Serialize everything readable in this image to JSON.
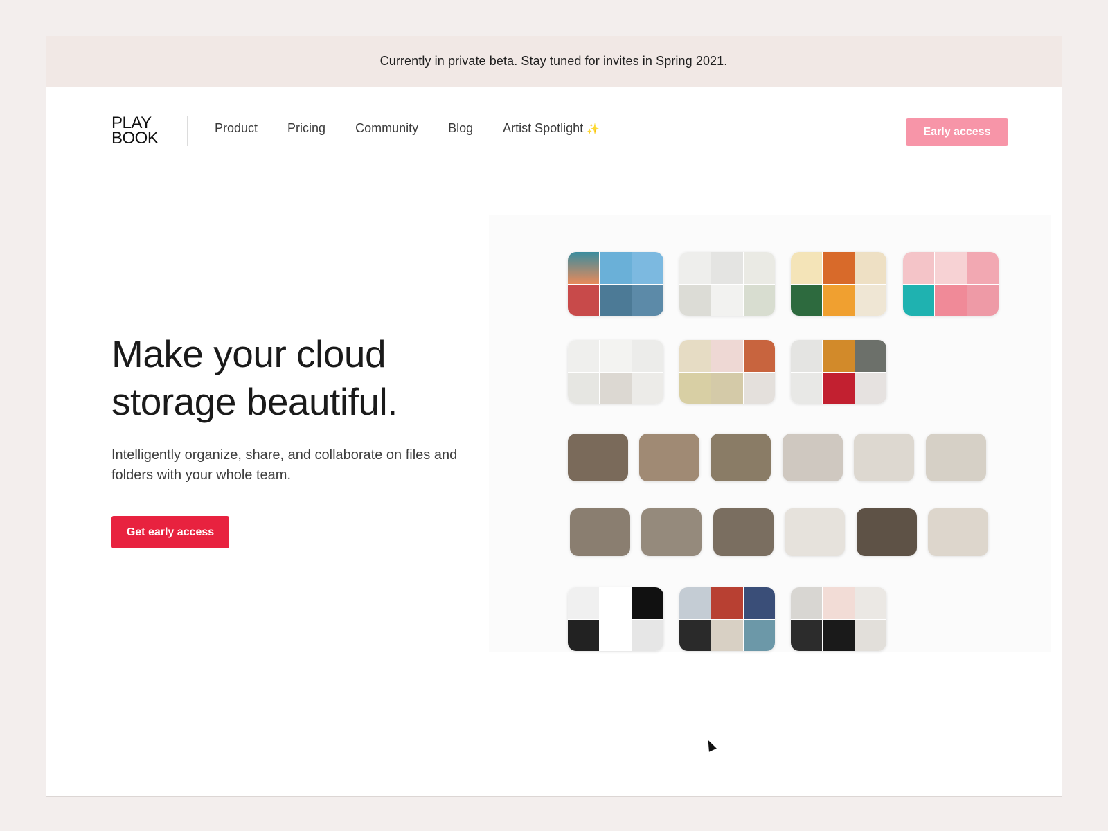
{
  "banner": {
    "text": "Currently in private beta.  Stay tuned for invites in Spring 2021."
  },
  "logo": {
    "line1": "PLAY",
    "line2": "BOOK"
  },
  "nav": {
    "links": [
      "Product",
      "Pricing",
      "Community",
      "Blog",
      "Artist Spotlight"
    ],
    "sparkle": "✨",
    "early_access": "Early access"
  },
  "hero": {
    "headline_line1": "Make your cloud",
    "headline_line2": "storage beautiful.",
    "subtext": "Intelligently organize, share, and collaborate on files and folders with your whole team.",
    "cta": "Get early access"
  },
  "colors": {
    "accent": "#e8223f",
    "accent_light": "#f795a8",
    "banner_bg": "#f1e8e5"
  }
}
